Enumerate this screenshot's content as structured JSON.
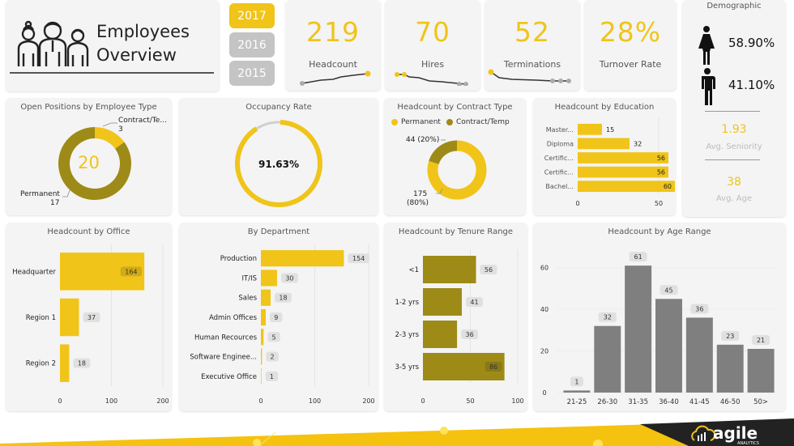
{
  "title": {
    "line1": "Employees",
    "line2": "Overview"
  },
  "colors": {
    "accent": "#f0c419",
    "olive": "#9e8a17",
    "grey_bar": "#7f7f7f",
    "card": "#f4f4f4"
  },
  "years": [
    {
      "label": "2017",
      "active": true
    },
    {
      "label": "2016",
      "active": false
    },
    {
      "label": "2015",
      "active": false
    }
  ],
  "kpis": [
    {
      "value": "219",
      "label": "Headcount"
    },
    {
      "value": "70",
      "label": "Hires"
    },
    {
      "value": "52",
      "label": "Terminations"
    },
    {
      "value": "28%",
      "label": "Turnover Rate"
    }
  ],
  "demographic": {
    "title": "Demographic",
    "female_pct": "58.90%",
    "male_pct": "41.10%",
    "avg_seniority": "1.93",
    "avg_seniority_label": "Avg. Seniority",
    "avg_age": "38",
    "avg_age_label": "Avg. Age"
  },
  "open_positions": {
    "title": "Open Positions by Employee Type",
    "total": "20",
    "slices": [
      {
        "name": "Permanent",
        "value": 17,
        "label": "Permanent",
        "value_label": "17"
      },
      {
        "name": "Contract/Te...",
        "value": 3,
        "label": "Contract/Te...",
        "value_label": "3"
      }
    ]
  },
  "occupancy": {
    "title": "Occupancy Rate",
    "value_label": "91.63%",
    "fraction": 0.9163
  },
  "contract": {
    "title": "Headcount by Contract Type",
    "legend": [
      "Permanent",
      "Contract/Temp"
    ],
    "slices": [
      {
        "name": "Permanent",
        "value": 175,
        "label1": "175",
        "label2": "(80%)"
      },
      {
        "name": "Contract/Temp",
        "value": 44,
        "label1": "44 (20%)"
      }
    ]
  },
  "chart_data": [
    {
      "id": "education",
      "type": "bar",
      "orientation": "horizontal",
      "title": "Headcount by Education",
      "categories": [
        "Master...",
        "Diploma",
        "Certific...",
        "Certific...",
        "Bachel..."
      ],
      "values": [
        15,
        32,
        56,
        56,
        60
      ],
      "xlim": [
        0,
        65
      ],
      "ticks": [
        "0",
        "50"
      ]
    },
    {
      "id": "office",
      "type": "bar",
      "orientation": "horizontal",
      "title": "Headcount by Office",
      "categories": [
        "Headquarter",
        "Region 1",
        "Region 2"
      ],
      "values": [
        164,
        37,
        18
      ],
      "xlim": [
        0,
        200
      ],
      "ticks": [
        "0",
        "100",
        "200"
      ]
    },
    {
      "id": "department",
      "type": "bar",
      "orientation": "horizontal",
      "title": "By Department",
      "categories": [
        "Production",
        "IT/IS",
        "Sales",
        "Admin Offices",
        "Human Recources",
        "Software Enginee...",
        "Executive Office"
      ],
      "values": [
        154,
        30,
        18,
        9,
        5,
        2,
        1
      ],
      "xlim": [
        0,
        200
      ],
      "ticks": [
        "0",
        "100",
        "200"
      ]
    },
    {
      "id": "tenure",
      "type": "bar",
      "orientation": "horizontal",
      "title": "Headcount by Tenure Range",
      "categories": [
        "<1",
        "1-2 yrs",
        "2-3 yrs",
        "3-5 yrs"
      ],
      "values": [
        56,
        41,
        36,
        86
      ],
      "xlim": [
        0,
        100
      ],
      "ticks": [
        "0",
        "50",
        "100"
      ]
    },
    {
      "id": "age",
      "type": "bar",
      "orientation": "vertical",
      "title": "Headcount by Age Range",
      "categories": [
        "21-25",
        "26-30",
        "31-35",
        "36-40",
        "41-45",
        "46-50",
        "50>"
      ],
      "values": [
        1,
        32,
        61,
        45,
        36,
        23,
        21
      ],
      "ylim": [
        0,
        70
      ],
      "ticks": [
        "0",
        "20",
        "40",
        "60"
      ]
    }
  ],
  "footer": {
    "brand": "agile",
    "sub": "ANALYTICS"
  }
}
